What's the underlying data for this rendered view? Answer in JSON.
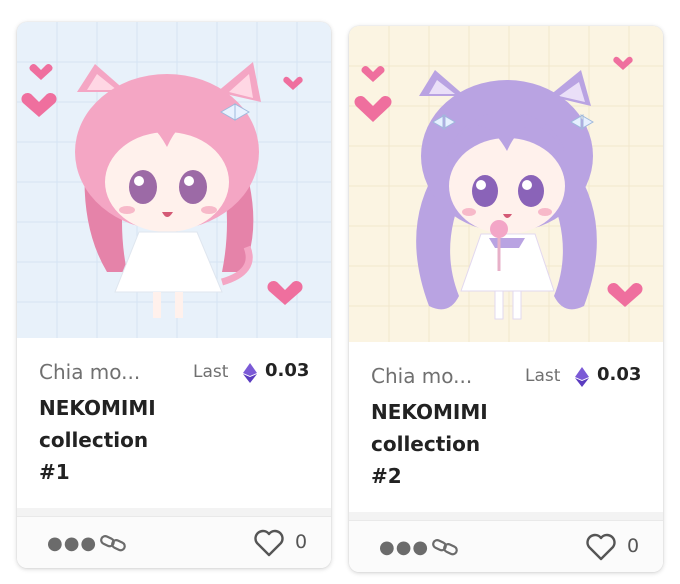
{
  "cards": [
    {
      "collection": "Chia mo...",
      "last_label": "Last",
      "price": "0.03",
      "title_lines": [
        "NEKOMIMI",
        "collection",
        "#1"
      ],
      "likes": "0",
      "theme": {
        "bg": "#e8f1fa",
        "hair": "#f4a6c4",
        "hair_dark": "#e583a9",
        "eyes": "#9c6aa6",
        "dress": "#ffffff"
      }
    },
    {
      "collection": "Chia mo...",
      "last_label": "Last",
      "price": "0.03",
      "title_lines": [
        "NEKOMIMI",
        "collection",
        "#2"
      ],
      "likes": "0",
      "theme": {
        "bg": "#fbf4e2",
        "hair": "#b9a3e2",
        "hair_dark": "#9a82d2",
        "eyes": "#8a63b8",
        "dress": "#ffffff"
      }
    }
  ],
  "icons": {
    "currency": "ethereum-icon",
    "more": "more-dots-icon",
    "link": "chain-link-icon",
    "like": "heart-icon"
  },
  "colors": {
    "accent_eth": "#7b5ad6",
    "heart_deco": "#ef6f9e"
  }
}
